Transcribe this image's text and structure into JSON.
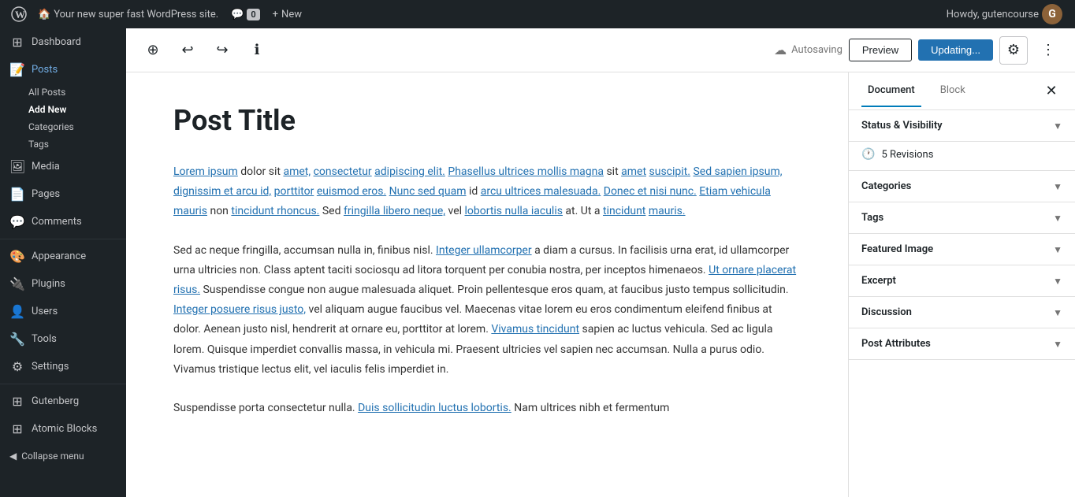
{
  "adminBar": {
    "logo": "⚙",
    "siteItem": {
      "icon": "🏠",
      "label": "Your new super fast WordPress site."
    },
    "comments": {
      "icon": "💬",
      "count": "0"
    },
    "new": {
      "icon": "+",
      "label": "New"
    },
    "user": {
      "label": "Howdy, gutencourse",
      "avatarLetter": "G"
    }
  },
  "sidebar": {
    "dashboard": {
      "icon": "⊞",
      "label": "Dashboard"
    },
    "posts": {
      "icon": "📝",
      "label": "Posts"
    },
    "sub_all_posts": "All Posts",
    "sub_add_new": "Add New",
    "sub_categories": "Categories",
    "sub_tags": "Tags",
    "media": {
      "icon": "🖼",
      "label": "Media"
    },
    "pages": {
      "icon": "📄",
      "label": "Pages"
    },
    "comments": {
      "icon": "💬",
      "label": "Comments"
    },
    "appearance": {
      "icon": "🎨",
      "label": "Appearance"
    },
    "plugins": {
      "icon": "🔌",
      "label": "Plugins"
    },
    "users": {
      "icon": "👤",
      "label": "Users"
    },
    "tools": {
      "icon": "🔧",
      "label": "Tools"
    },
    "settings": {
      "icon": "⚙",
      "label": "Settings"
    },
    "gutenberg": {
      "icon": "⊞",
      "label": "Gutenberg"
    },
    "atomic_blocks": {
      "icon": "⊞",
      "label": "Atomic Blocks"
    },
    "collapse": {
      "icon": "◀",
      "label": "Collapse menu"
    }
  },
  "toolbar": {
    "add_block_title": "+",
    "undo_title": "↩",
    "redo_title": "↪",
    "info_title": "ℹ",
    "autosaving": "Autosaving",
    "preview": "Preview",
    "update": "Updating...",
    "settings_icon": "⚙",
    "more_icon": "⋮"
  },
  "post": {
    "title": "Post Title",
    "paragraphs": [
      "Lorem ipsum dolor sit amet, consectetur adipiscing elit. Phasellus ultrices mollis magna sit amet suscipit. Sed sapien ipsum, dignissim et arcu id, porttitor euismod eros. Nunc sed quam id arcu ultrices malesuada. Donec et nisi nunc. Etiam vehicula mauris non tincidunt rhoncus. Sed fringilla libero neque, vel lobortis nulla iaculis at. Ut a tincidunt mauris.",
      "Sed ac neque fringilla, accumsan nulla in, finibus nisl. Integer ullamcorper a diam a cursus. In facilisis urna erat, id ullamcorper urna ultricies non. Class aptent taciti sociosqu ad litora torquent per conubia nostra, per inceptos himenaeos. Ut ornare placerat risus. Suspendisse congue non augue malesuada aliquet. Proin pellentesque eros quam, at faucibus justo tempus sollicitudin. Integer posuere risus justo, vel aliquam augue faucibus vel. Maecenas vitae lorem eu eros condimentum eleifend finibus at dolor. Aenean justo nisl, hendrerit at ornare eu, porttitor at lorem. Vivamus tincidunt sapien ac luctus vehicula. Sed ac ligula lorem. Quisque imperdiet convallis massa, in vehicula mi. Praesent ultricies vel sapien nec accumsan. Nulla a purus odio. Vivamus tristique lectus elit, vel iaculis felis imperdiet in.",
      "Suspendisse porta consectetur nulla. Duis sollicitudin luctus lobortis. Nam ultrices nibh et fermentum"
    ]
  },
  "rightPanel": {
    "tabs": [
      {
        "label": "Document",
        "active": true
      },
      {
        "label": "Block",
        "active": false
      }
    ],
    "close": "✕",
    "sections": [
      {
        "label": "Status & Visibility",
        "expanded": true
      },
      {
        "label": "5 Revisions",
        "isRevision": true
      },
      {
        "label": "Categories",
        "expanded": false
      },
      {
        "label": "Tags",
        "expanded": false
      },
      {
        "label": "Featured Image",
        "expanded": false
      },
      {
        "label": "Excerpt",
        "expanded": false
      },
      {
        "label": "Discussion",
        "expanded": false
      },
      {
        "label": "Post Attributes",
        "expanded": false
      }
    ],
    "revisions_icon": "🕐",
    "revisions_count": "5 Revisions"
  }
}
